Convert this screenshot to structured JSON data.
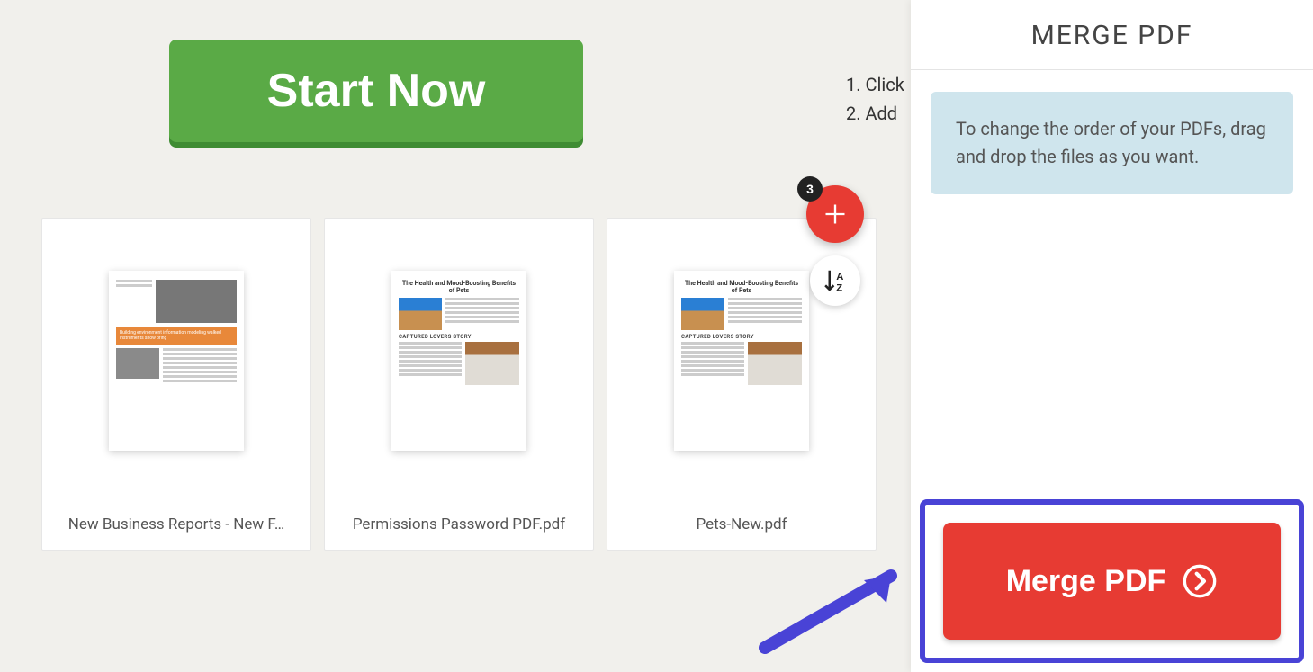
{
  "main": {
    "start_button_label": "Start Now",
    "instructions": [
      "1. Click",
      "2. Add"
    ],
    "files": [
      {
        "name": "New Business Reports - New F…",
        "doc_title": ""
      },
      {
        "name": "Permissions Password PDF.pdf",
        "doc_title": "The Health and Mood-Boosting Benefits of Pets"
      },
      {
        "name": "Pets-New.pdf",
        "doc_title": "The Health and Mood-Boosting Benefits of Pets"
      }
    ],
    "add_badge_count": "3"
  },
  "panel": {
    "title": "MERGE PDF",
    "info_text": "To change the order of your PDFs, drag and drop the files as you want.",
    "merge_button_label": "Merge PDF"
  },
  "colors": {
    "accent_green": "#5aaa46",
    "accent_red": "#e73b33",
    "highlight_blue": "#4943d6"
  }
}
